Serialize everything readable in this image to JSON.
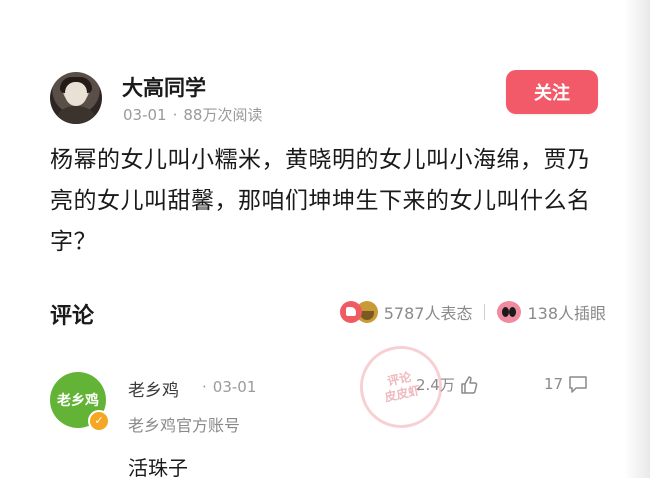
{
  "post": {
    "author": "大高同学",
    "date": "03-01",
    "views": "88万次阅读",
    "follow_label": "关注",
    "text": "杨幂的女儿叫小糯米，黄晓明的女儿叫小海绵，贾乃亮的女儿叫甜馨，那咱们坤坤生下来的女儿叫什么名字？"
  },
  "comments_section": {
    "title": "评论",
    "reactions_count": "5787人表态",
    "eyes_count": "138人插眼"
  },
  "comment": {
    "avatar_text": "老乡鸡",
    "name": "老乡鸡",
    "date": "03-01",
    "subtitle": "老乡鸡官方账号",
    "text": "活珠子",
    "likes": "2.4万",
    "replies": "17"
  },
  "stamp": {
    "line1": "评论",
    "line2": "皮皮虾"
  },
  "colors": {
    "follow_button": "#f25a6a",
    "comment_avatar": "#63b436",
    "verified_badge": "#f5a623"
  }
}
